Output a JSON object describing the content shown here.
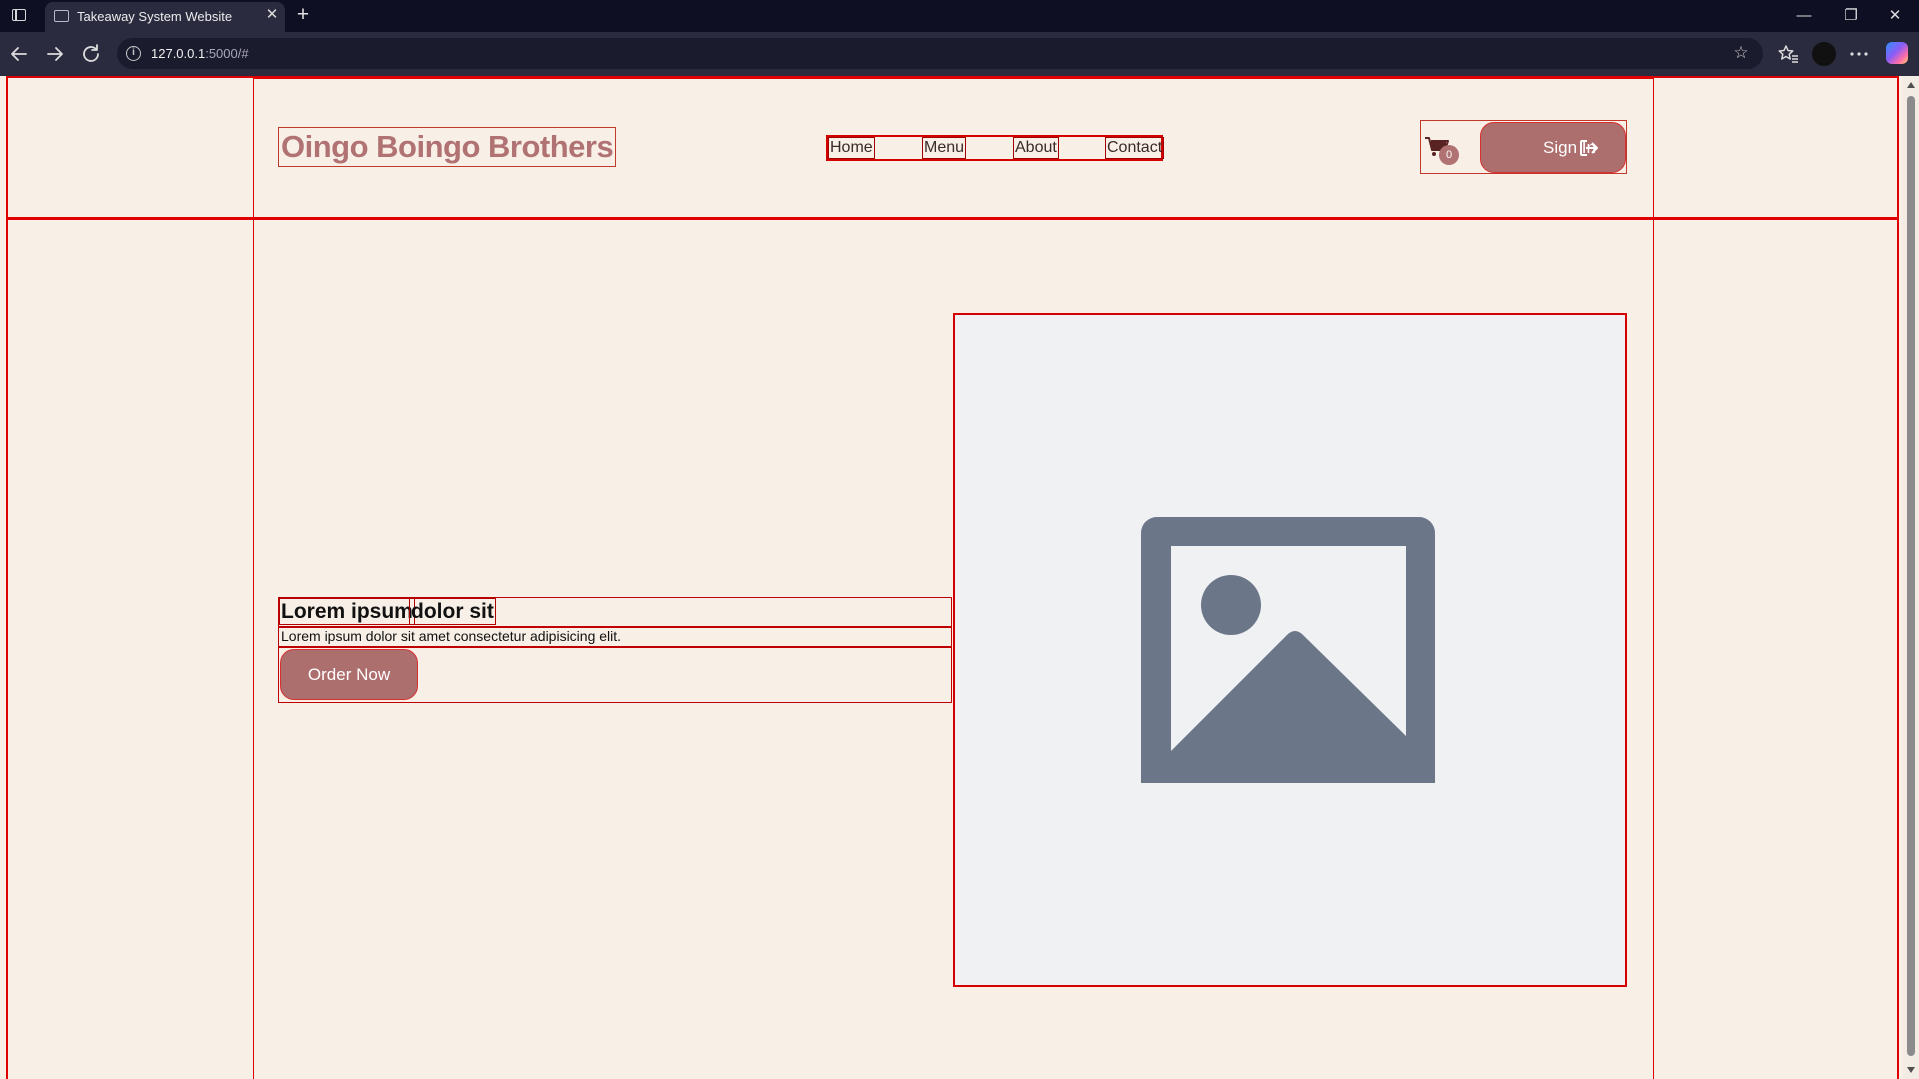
{
  "browser": {
    "tab_title": "Takeaway System Website",
    "tab_close": "✕",
    "new_tab": "+",
    "url_host": "127.0.0.1",
    "url_rest": ":5000/#",
    "window_controls": {
      "minimize": "—",
      "restore": "❐",
      "close": "✕"
    }
  },
  "header": {
    "logo": "Oingo Boingo Brothers",
    "nav": [
      {
        "label": "Home"
      },
      {
        "label": "Menu"
      },
      {
        "label": "About"
      },
      {
        "label": "Contact"
      }
    ],
    "cart_count": "0",
    "signin_label": "Sign In"
  },
  "hero": {
    "title_words": [
      "Lorem ipsum",
      "dolor sit"
    ],
    "subtitle": "Lorem ipsum dolor sit amet consectetur adipisicing elit.",
    "cta_label": "Order Now"
  },
  "colors": {
    "page_background": "#f8efe6",
    "accent": "#ad6e6e",
    "outline": "#e00000",
    "placeholder": "#6b7789"
  }
}
